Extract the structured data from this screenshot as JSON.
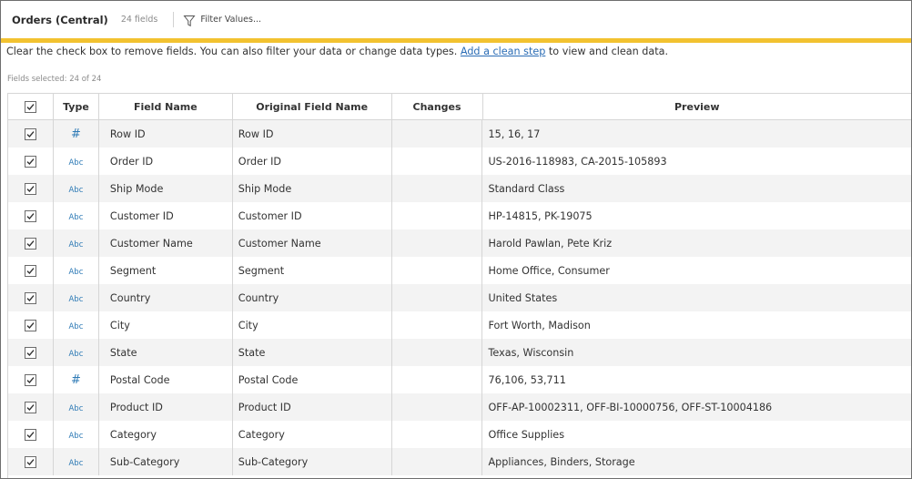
{
  "header": {
    "title": "Orders (Central)",
    "field_count": "24 fields",
    "filter_label": "Filter Values..."
  },
  "info": {
    "text_before": "Clear the check box to remove fields. You can also filter your data or change data types. ",
    "link": "Add a clean step",
    "text_after": " to view and clean data."
  },
  "fields_selected": "Fields selected: 24 of 24",
  "columns": {
    "type": "Type",
    "field_name": "Field Name",
    "original_field_name": "Original Field Name",
    "changes": "Changes",
    "preview": "Preview"
  },
  "type_labels": {
    "number": "#",
    "string": "Abc"
  },
  "colors": {
    "accent_bar": "#f2c230",
    "type_icon": "#2f7bb6",
    "link": "#2a6cb5"
  },
  "rows": [
    {
      "checked": true,
      "type": "number",
      "field_name": "Row ID",
      "original": "Row ID",
      "changes": "",
      "preview": "15, 16, 17"
    },
    {
      "checked": true,
      "type": "string",
      "field_name": "Order ID",
      "original": "Order ID",
      "changes": "",
      "preview": "US-2016-118983, CA-2015-105893"
    },
    {
      "checked": true,
      "type": "string",
      "field_name": "Ship Mode",
      "original": "Ship Mode",
      "changes": "",
      "preview": "Standard Class"
    },
    {
      "checked": true,
      "type": "string",
      "field_name": "Customer ID",
      "original": "Customer ID",
      "changes": "",
      "preview": "HP-14815, PK-19075"
    },
    {
      "checked": true,
      "type": "string",
      "field_name": "Customer Name",
      "original": "Customer Name",
      "changes": "",
      "preview": "Harold Pawlan, Pete Kriz"
    },
    {
      "checked": true,
      "type": "string",
      "field_name": "Segment",
      "original": "Segment",
      "changes": "",
      "preview": "Home Office, Consumer"
    },
    {
      "checked": true,
      "type": "string",
      "field_name": "Country",
      "original": "Country",
      "changes": "",
      "preview": "United States"
    },
    {
      "checked": true,
      "type": "string",
      "field_name": "City",
      "original": "City",
      "changes": "",
      "preview": "Fort Worth, Madison"
    },
    {
      "checked": true,
      "type": "string",
      "field_name": "State",
      "original": "State",
      "changes": "",
      "preview": "Texas, Wisconsin"
    },
    {
      "checked": true,
      "type": "number",
      "field_name": "Postal Code",
      "original": "Postal Code",
      "changes": "",
      "preview": "76,106, 53,711"
    },
    {
      "checked": true,
      "type": "string",
      "field_name": "Product ID",
      "original": "Product ID",
      "changes": "",
      "preview": "OFF-AP-10002311, OFF-BI-10000756, OFF-ST-10004186"
    },
    {
      "checked": true,
      "type": "string",
      "field_name": "Category",
      "original": "Category",
      "changes": "",
      "preview": "Office Supplies"
    },
    {
      "checked": true,
      "type": "string",
      "field_name": "Sub-Category",
      "original": "Sub-Category",
      "changes": "",
      "preview": "Appliances, Binders, Storage"
    }
  ]
}
